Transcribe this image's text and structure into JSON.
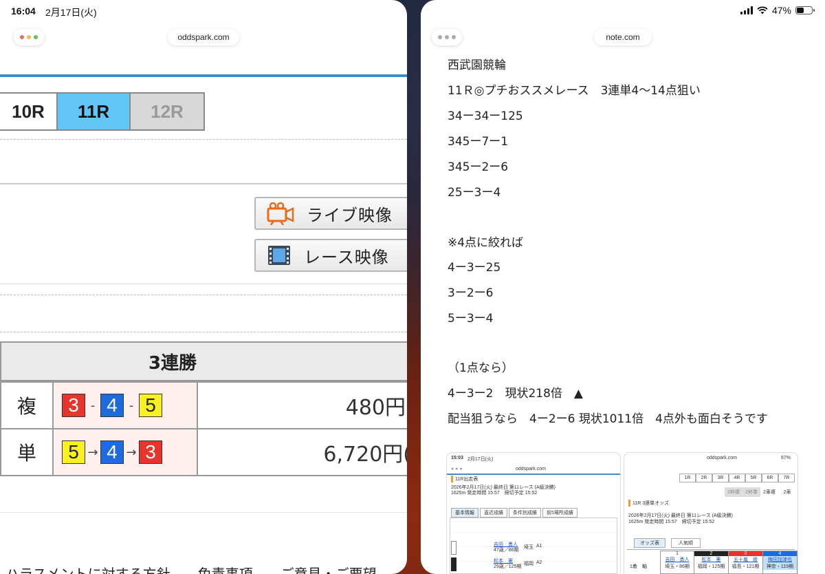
{
  "status_bar": {
    "time": "16:04",
    "date": "2月17日(火)",
    "battery": "47%",
    "battery_level": 0.47
  },
  "left_window": {
    "url": "oddspark.com",
    "race_tabs": [
      {
        "label": "10R",
        "state": "normal"
      },
      {
        "label": "11R",
        "state": "selected"
      },
      {
        "label": "12R",
        "state": "disabled"
      }
    ],
    "buttons": {
      "live": "ライブ映像",
      "race": "レース映像"
    },
    "result": {
      "header": "3連勝",
      "rows": [
        {
          "type": "複",
          "nums": [
            "3",
            "4",
            "5"
          ],
          "sep": "-",
          "payout": "480円"
        },
        {
          "type": "単",
          "nums": [
            "5",
            "4",
            "3"
          ],
          "sep": "→",
          "payout": "6,720円("
        }
      ]
    },
    "footer": "ハラスメントに対する方針　　免責事項　　ご意見・ご要望"
  },
  "colors": {
    "car_3": "#e8352b",
    "car_4": "#1e6be0",
    "car_5": "#f8f020",
    "selected_tab": "#62c6f7",
    "accent_rule": "#3b8fd1"
  },
  "right_window": {
    "url": "note.com",
    "lines": [
      "西武園競輪",
      "11Ｒ◎プチおススメレース　3連単4〜14点狙い",
      "34ー34ー125",
      "345ー7ー1",
      "345ー2ー6",
      "25ー3ー4",
      "※4点に絞れば",
      "4ー3ー25",
      "3ー2ー6",
      "5ー3ー4",
      "（1点なら）",
      "4ー3ー2　現状218倍　▲",
      "配当狙うなら　4ー2ー6 現状1011倍　4点外も面白そうです"
    ],
    "thumb1": {
      "time": "15:03",
      "date": "2月17日(火)",
      "url": "oddspark.com",
      "title": "11R出走表",
      "meta1": "2026年2月17日(火) 最終日 第11レース (A級決勝)",
      "meta2": "1625m 発走時間 15:57　締切予定 15:52",
      "tabs": [
        "基本情報",
        "直近成績",
        "条件別成績",
        "前5場所成績"
      ],
      "riders": [
        {
          "name": "吉田　勇人",
          "sub": "47歳／86期",
          "pref": "埼玉",
          "cls": "A1"
        },
        {
          "name": "松本　憲",
          "sub": "29歳／125期",
          "pref": "福岡",
          "cls": "A2"
        }
      ]
    },
    "thumb2": {
      "url": "oddspark.com",
      "battery": "67%",
      "race_tabs": [
        "1R",
        "2R",
        "3R",
        "4R",
        "5R",
        "6R",
        "7R"
      ],
      "bet_tabs": [
        "2枠複",
        "2枠単",
        "2車複",
        "2車"
      ],
      "title": "11R 3連単オッズ",
      "meta1": "2026年2月17日(火) 最終日 第11レース (A級決勝)",
      "meta2": "1625m 発走時間 15:57　締切予定 15:52",
      "sub_tabs": [
        "オッズ表",
        "人気順"
      ],
      "axis_label": "1着",
      "axis_suffix": "軸",
      "cols": [
        {
          "no": "1",
          "name": "吉田　勇人",
          "info": "埼玉・86期"
        },
        {
          "no": "2",
          "name": "松本　憲",
          "info": "福岡・125期"
        },
        {
          "no": "3",
          "name": "五十嵐　綾",
          "info": "福島・121期"
        },
        {
          "no": "4",
          "name": "梅田加津也",
          "info": "神奈・119期"
        }
      ]
    }
  }
}
